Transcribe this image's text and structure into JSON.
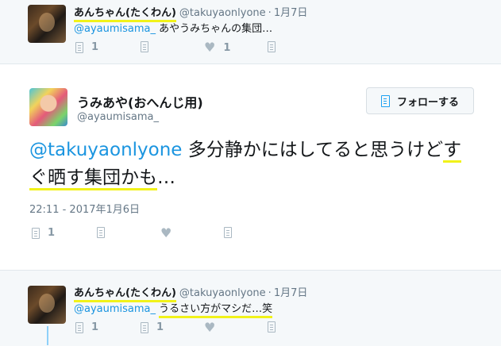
{
  "reply_top": {
    "name": "あんちゃん(たくわん)",
    "handle": "@takuyaonlyone",
    "separator": "·",
    "time": "1月7日",
    "mention": "@ayaumisama_",
    "text": "あやうみちゃんの集団…",
    "actions": {
      "reply_count": "1",
      "like_count": "1"
    }
  },
  "main": {
    "name": "うみあや(おへんじ用)",
    "handle": "@ayaumisama_",
    "follow_label": "フォローする",
    "mention": "@takuyaonlyone",
    "text_before_hl": " 多分静かにはしてると思うけど",
    "text_hl": "すぐ晒す集団かも",
    "text_after_hl": "…",
    "timestamp": "22:11 - 2017年1月6日",
    "actions": {
      "reply_count": "1"
    }
  },
  "reply_bottom": {
    "name": "あんちゃん(たくわん)",
    "handle": "@takuyaonlyone",
    "separator": "·",
    "time": "1月7日",
    "mention": "@ayaumisama_",
    "text": "うるさい方がマシだ…笑",
    "actions": {
      "reply_count": "1",
      "retweet_count": "1"
    }
  },
  "colors": {
    "link": "#1b95e0",
    "highlight": "#f1f21a",
    "muted": "#657786"
  }
}
